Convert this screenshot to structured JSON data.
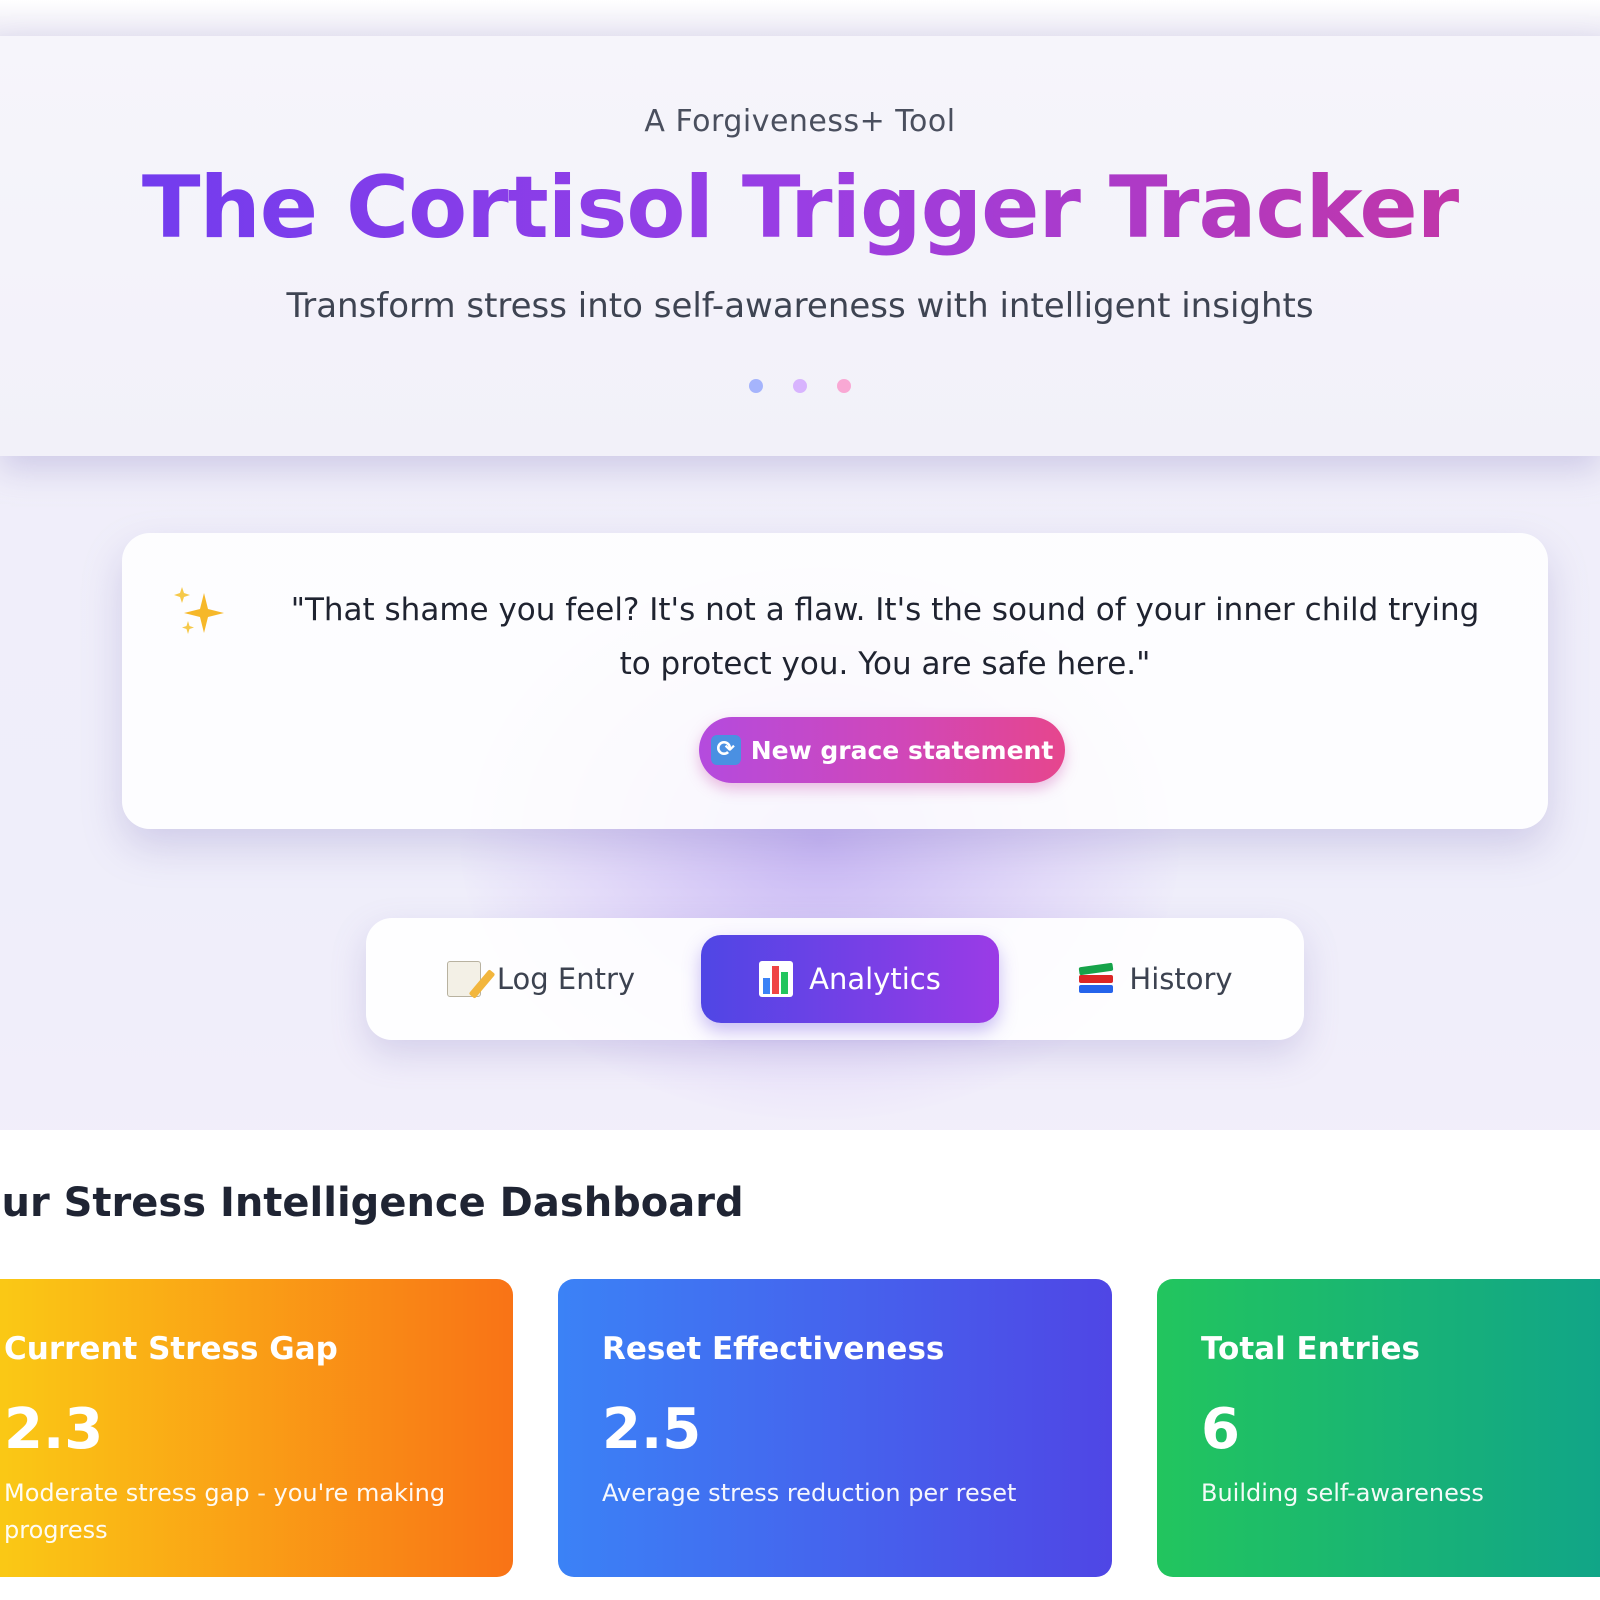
{
  "header": {
    "eyebrow": "A Forgiveness+ Tool",
    "title": "The Cortisol Trigger Tracker",
    "subtitle": "Transform stress into self-awareness with intelligent insights",
    "dot_colors": [
      "#a5b4fc",
      "#d8b4fe",
      "#f9a8d4"
    ]
  },
  "grace": {
    "icon": "sparkles-icon",
    "quote": "\"That shame you feel? It's not a flaw. It's the sound of your inner child trying to protect you. You are safe here.\"",
    "button_label": "New grace statement",
    "button_icon": "refresh-icon"
  },
  "tabs": [
    {
      "label": "Log Entry",
      "icon": "memo-icon",
      "active": false
    },
    {
      "label": "Analytics",
      "icon": "bar-chart-icon",
      "active": true
    },
    {
      "label": "History",
      "icon": "books-icon",
      "active": false
    }
  ],
  "dashboard": {
    "title": "our Stress Intelligence Dashboard",
    "cards": [
      {
        "label": "Current Stress Gap",
        "value": "2.3",
        "description": "Moderate stress gap - you're making progress",
        "colors": [
          "#facc15",
          "#f97316"
        ]
      },
      {
        "label": "Reset Effectiveness",
        "value": "2.5",
        "description": "Average stress reduction per reset",
        "colors": [
          "#3b82f6",
          "#4f46e5"
        ]
      },
      {
        "label": "Total Entries",
        "value": "6",
        "description": "Building self-awareness",
        "colors": [
          "#22c55e",
          "#10a38a"
        ]
      }
    ]
  },
  "colors": {
    "title_gradient": [
      "#6a3cf0",
      "#c9349c"
    ],
    "accent": "#7b3fe6"
  }
}
